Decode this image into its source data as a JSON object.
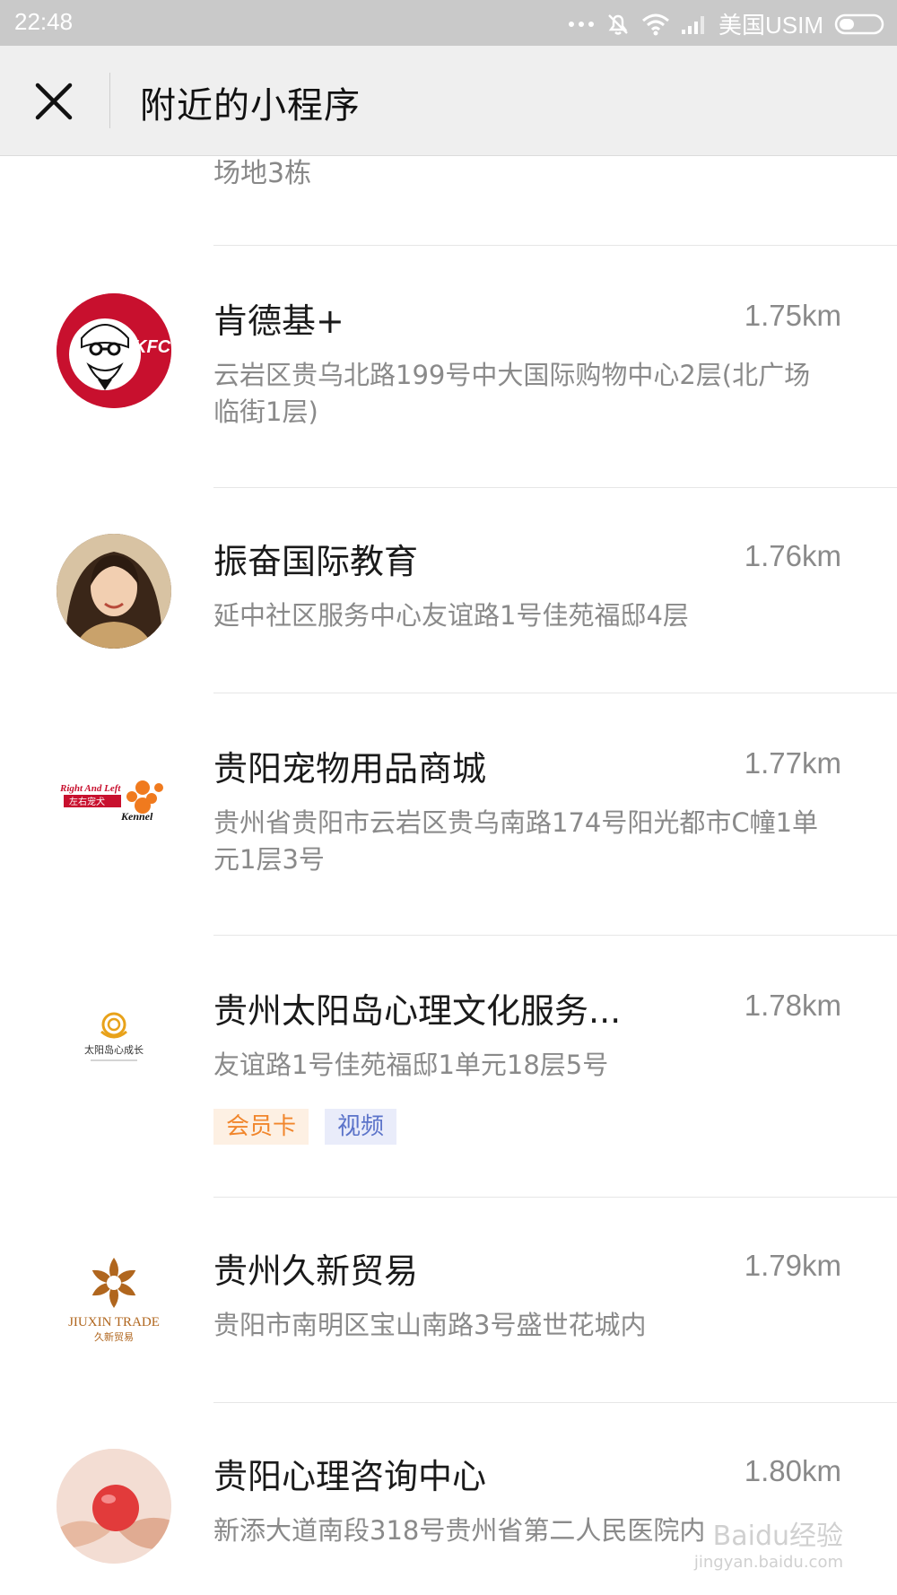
{
  "status_bar": {
    "time": "22:48",
    "carrier": "美国USIM"
  },
  "header": {
    "title": "附近的小程序"
  },
  "partial_item": {
    "address": "场地3栋"
  },
  "items": [
    {
      "name": "肯德基+",
      "distance": "1.75km",
      "address": "云岩区贵乌北路199号中大国际购物中心2层(北广场临街1层)",
      "logo_text": "KFC"
    },
    {
      "name": "振奋国际教育",
      "distance": "1.76km",
      "address": "延中社区服务中心友谊路1号佳苑福邸4层"
    },
    {
      "name": "贵阳宠物用品商城",
      "distance": "1.77km",
      "address": "贵州省贵阳市云岩区贵乌南路174号阳光都市C幢1单元1层3号",
      "logo_text": {
        "line1": "Right And Left",
        "line2": "左右宠犬",
        "line3": "Kennel"
      }
    },
    {
      "name": "贵州太阳岛心理文化服务...",
      "distance": "1.78km",
      "address": "友谊路1号佳苑福邸1单元18层5号",
      "tags": [
        "会员卡",
        "视频"
      ],
      "logo_text": {
        "line1": "太阳岛心成长"
      }
    },
    {
      "name": "贵州久新贸易",
      "distance": "1.79km",
      "address": "贵阳市南明区宝山南路3号盛世花城内",
      "logo_text": {
        "line1": "JIUXIN TRADE",
        "line2": "久新贸易"
      }
    },
    {
      "name": "贵阳心理咨询中心",
      "distance": "1.80km",
      "address": "新添大道南段318号贵州省第二人民医院内"
    }
  ],
  "watermark": {
    "text": "Baidu经验",
    "url_text": "jingyan.baidu.com"
  },
  "colors": {
    "tag_orange": "#f1862c",
    "tag_blue": "#5b73c9",
    "header_bg": "#efefef",
    "status_bg": "#c9c9c9"
  }
}
